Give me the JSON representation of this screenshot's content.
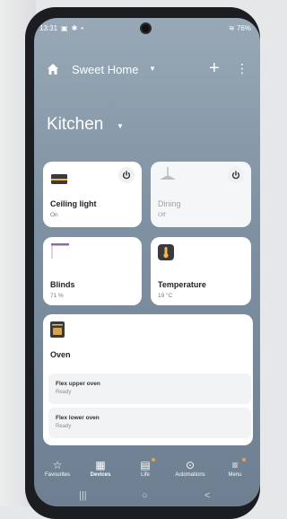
{
  "status": {
    "time": "13:31",
    "battery": "76%"
  },
  "header": {
    "home_name": "Sweet Home"
  },
  "room": {
    "name": "Kitchen"
  },
  "devices": [
    {
      "name": "Ceiling light",
      "state": "On"
    },
    {
      "name": "Dining",
      "state": "Off"
    },
    {
      "name": "Blinds",
      "state": "71 %"
    },
    {
      "name": "Temperature",
      "state": "19 °C"
    }
  ],
  "oven": {
    "name": "Oven",
    "items": [
      {
        "name": "Flex upper oven",
        "state": "Ready"
      },
      {
        "name": "Flex lower oven",
        "state": "Ready"
      }
    ]
  },
  "nav": [
    {
      "label": "Favourites"
    },
    {
      "label": "Devices"
    },
    {
      "label": "Life"
    },
    {
      "label": "Automations"
    },
    {
      "label": "Menu"
    }
  ],
  "colors": {
    "accent": "#f2a041"
  }
}
